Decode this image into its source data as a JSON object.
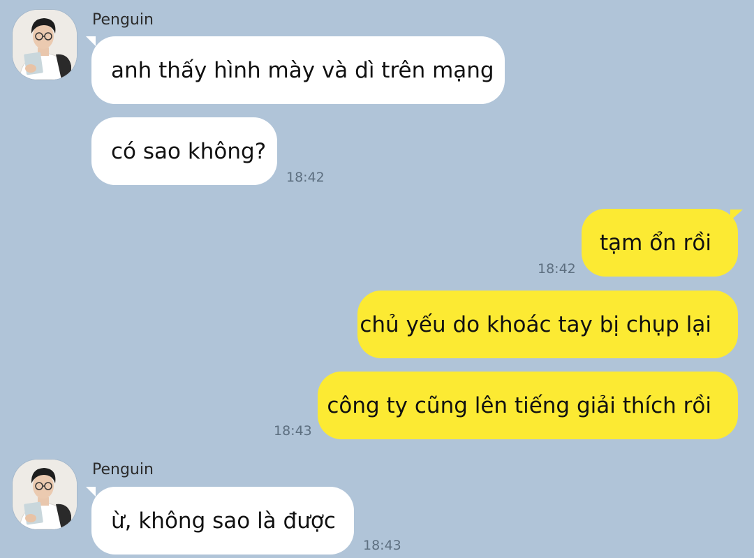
{
  "messages": [
    {
      "sender": "Penguin",
      "text": "anh thấy hình mày và dì trên mạng"
    },
    {
      "text": "có sao không?",
      "time": "18:42"
    },
    {
      "text": "tạm ổn rồi",
      "time": "18:42"
    },
    {
      "text": "chủ yếu do khoác tay bị chụp lại"
    },
    {
      "text": "công ty cũng lên tiếng giải thích rồi",
      "time": "18:43"
    },
    {
      "sender": "Penguin",
      "text": "ừ, không sao là được",
      "time": "18:43"
    }
  ],
  "colors": {
    "background": "#b0c4d8",
    "incoming_bubble": "#ffffff",
    "outgoing_bubble": "#fcea33",
    "timestamp": "#5d6f80"
  },
  "icons": [
    "avatar-penguin-photo"
  ]
}
